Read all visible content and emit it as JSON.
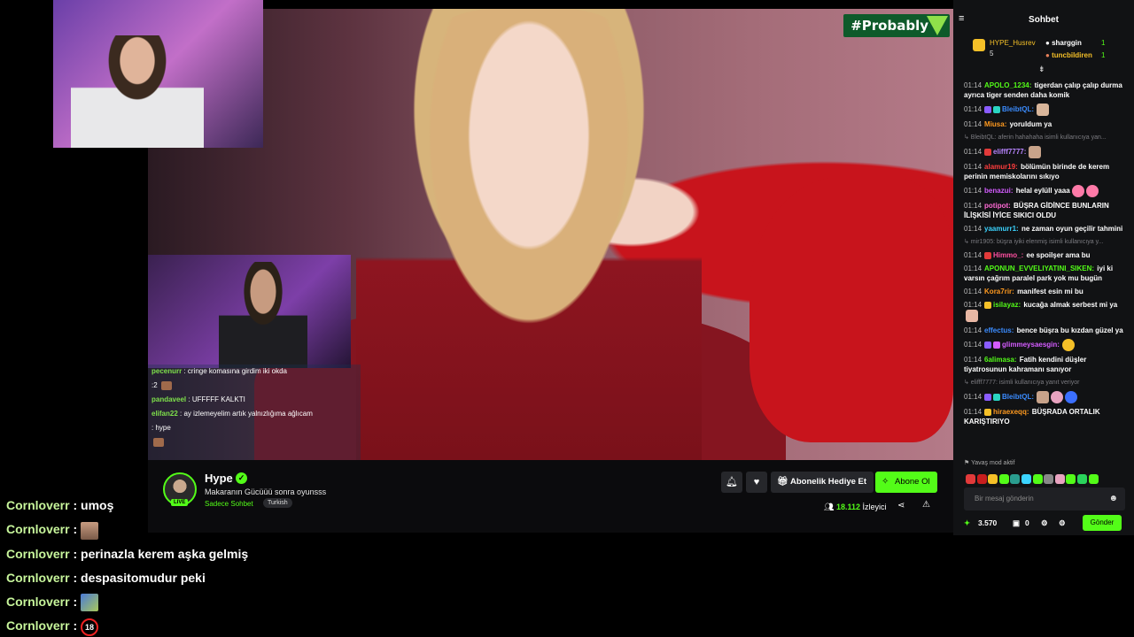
{
  "video": {
    "hashtag": "#Probably",
    "overlay_chat": [
      {
        "user": "pecenurr",
        "text": ": cringe komasına girdim iki okda"
      },
      {
        "user": "",
        "text": ":2"
      },
      {
        "user": "pandaveel",
        "text": ": UFFFFF KALKTI"
      },
      {
        "user": "elifan22",
        "text": ": ay izlemeyelim artık yalnızlığıma ağlıcam"
      },
      {
        "user": "",
        "text": ": hype"
      },
      {
        "user": "",
        "text": ""
      }
    ]
  },
  "stream": {
    "streamer": "Hype",
    "title": "Makaranın Gücüüü sonra oyunsss",
    "category": "Sadece Sohbet",
    "language": "Turkish",
    "live_label": "LIVE",
    "gift_label": "Abonelik Hediye Et",
    "subscribe_label": "Abone Ol",
    "viewers_count": "18.112",
    "viewers_label": "İzleyici"
  },
  "chat": {
    "title": "Sohbet",
    "leaders": [
      {
        "name": "HYPE_Husrev",
        "count": "5"
      },
      {
        "name": "sharggin",
        "count": "1"
      },
      {
        "name": "tuncbildiren",
        "count": "1"
      }
    ],
    "messages": [
      {
        "time": "01:14",
        "user": "APOLO_1234:",
        "color": "#53fc18",
        "text": "tigerdan çalıp çalıp durma ayrıca tiger senden daha komik"
      },
      {
        "time": "01:14",
        "user": "BleibtQL:",
        "color": "#3b8cff",
        "text": ""
      },
      {
        "time": "01:14",
        "user": "Miusa:",
        "color": "#ff9a1f",
        "text": "yoruldum ya"
      },
      {
        "time": "",
        "user": "",
        "color": "",
        "text": "↳ BleibtQL: aferin hahahaha isimli kullanıcıya yan..."
      },
      {
        "time": "01:14",
        "user": "elifff7777:",
        "color": "#b884ff",
        "text": ""
      },
      {
        "time": "01:14",
        "user": "alamur19:",
        "color": "#ff3d3d",
        "text": "bölümün birinde de kerem perinin memiskolarını sıkıyo"
      },
      {
        "time": "01:14",
        "user": "benazui:",
        "color": "#d45cff",
        "text": "helal eylüll yaaa"
      },
      {
        "time": "01:14",
        "user": "potipot:",
        "color": "#ff6ad5",
        "text": "BÜŞRA GİDİNCE BUNLARIN İLİŞKİSİ İYİCE SIKICI OLDU"
      },
      {
        "time": "01:14",
        "user": "yaamurr1:",
        "color": "#3bd4ff",
        "text": "ne zaman oyun geçilir tahmini"
      },
      {
        "time": "",
        "user": "",
        "color": "",
        "text": "↳ mir1905: büşra iyiki elenmiş isimli kullanıcıya y..."
      },
      {
        "time": "01:14",
        "user": "Himmo_:",
        "color": "#ff4fa0",
        "text": "ee spoilşer ama bu"
      },
      {
        "time": "01:14",
        "user": "APONUN_EVVELIYATINI_SIKEN:",
        "color": "#53fc18",
        "text": "iyi ki varsın çağrım paralel park yok mu bugün"
      },
      {
        "time": "01:14",
        "user": "Kora7rir:",
        "color": "#ff9a1f",
        "text": "manifest esin mi bu"
      },
      {
        "time": "01:14",
        "user": "isilayaz:",
        "color": "#53fc18",
        "text": "kucağa almak serbest mi ya"
      },
      {
        "time": "01:14",
        "user": "effectus:",
        "color": "#3b8cff",
        "text": "bence büşra bu kızdan güzel ya"
      },
      {
        "time": "01:14",
        "user": "glimmeysaesgin:",
        "color": "#d45cff",
        "text": ""
      },
      {
        "time": "01:14",
        "user": "6alimasa:",
        "color": "#53fc18",
        "text": "Fatih kendini düşler tiyatrosunun kahramanı sanıyor"
      },
      {
        "time": "",
        "user": "",
        "color": "",
        "text": "↳ elifff7777: isimli kullanıcıya yanıt veriyor"
      },
      {
        "time": "01:14",
        "user": "BleibtQL:",
        "color": "#3b8cff",
        "text": ""
      },
      {
        "time": "01:14",
        "user": "hiraexeqq:",
        "color": "#ff9a1f",
        "text": "BÜŞRADA ORTALIK KARIŞTIRIYO"
      }
    ],
    "slow_mode": "Yavaş mod aktif",
    "input_placeholder": "Bir mesaj gönderin",
    "points": "3.570",
    "gifts_count": "0",
    "send_label": "Gönder"
  },
  "overlay": {
    "lines": [
      {
        "user": "Cornloverr",
        "text": ": umoş",
        "image": ""
      },
      {
        "user": "Cornloverr",
        "text": ":",
        "image": "face"
      },
      {
        "user": "Cornloverr",
        "text": ": perinazla kerem aşka gelmiş",
        "image": ""
      },
      {
        "user": "Cornloverr",
        "text": ": despasitomudur peki",
        "image": ""
      },
      {
        "user": "Cornloverr",
        "text": ":",
        "image": "map"
      },
      {
        "user": "Cornloverr",
        "text": ":",
        "image": "18"
      }
    ],
    "age_label": "18"
  },
  "colors": {
    "accent": "#53fc18",
    "panel": "#111214",
    "button": "#26272b"
  }
}
